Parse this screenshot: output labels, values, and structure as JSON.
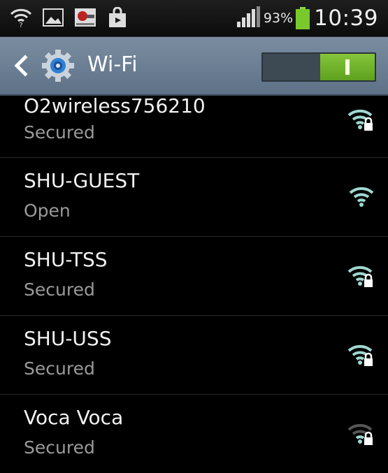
{
  "status_bar": {
    "battery_percent": "93%",
    "time": "10:39",
    "icons": [
      "wifi-notification-icon",
      "gallery-icon",
      "app-notification-icon",
      "shopping-bag-icon",
      "signal-icon",
      "battery-icon"
    ]
  },
  "action_bar": {
    "title": "Wi-Fi",
    "toggle_state": "on",
    "accent_color": "#6cb32a"
  },
  "networks": [
    {
      "ssid": "O2wireless756210",
      "security": "Secured",
      "locked": true,
      "signal": "strong"
    },
    {
      "ssid": "SHU-GUEST",
      "security": "Open",
      "locked": false,
      "signal": "strong"
    },
    {
      "ssid": "SHU-TSS",
      "security": "Secured",
      "locked": true,
      "signal": "strong"
    },
    {
      "ssid": "SHU-USS",
      "security": "Secured",
      "locked": true,
      "signal": "strong"
    },
    {
      "ssid": "Voca Voca",
      "security": "Secured",
      "locked": true,
      "signal": "weak"
    }
  ]
}
